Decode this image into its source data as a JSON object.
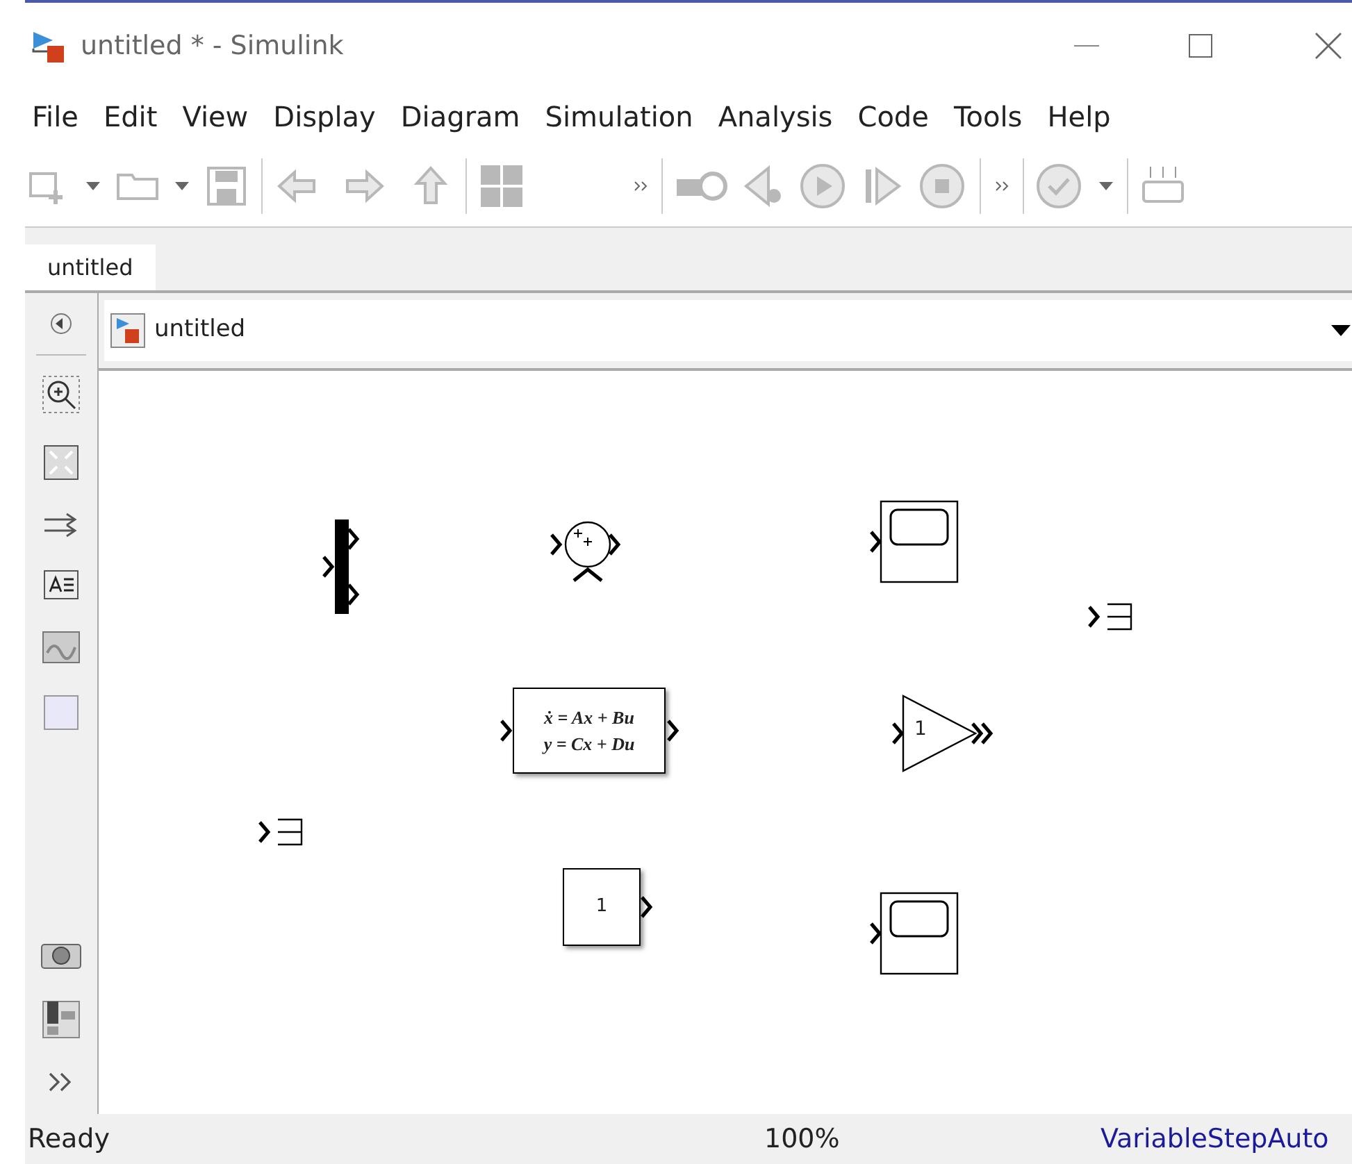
{
  "window": {
    "title": "untitled * - Simulink"
  },
  "menu": [
    "File",
    "Edit",
    "View",
    "Display",
    "Diagram",
    "Simulation",
    "Analysis",
    "Code",
    "Tools",
    "Help"
  ],
  "tabs": [
    {
      "label": "untitled",
      "selected": true
    }
  ],
  "address_bar": {
    "path": "untitled"
  },
  "blocks": [
    {
      "kind": "mux"
    },
    {
      "kind": "sum"
    },
    {
      "kind": "scope"
    },
    {
      "kind": "terminator"
    },
    {
      "kind": "state_space",
      "lines": [
        "ẋ = Ax + Bu",
        "y = Cx + Du"
      ]
    },
    {
      "kind": "gain",
      "label": "1"
    },
    {
      "kind": "terminator"
    },
    {
      "kind": "constant",
      "label": "1"
    },
    {
      "kind": "scope"
    }
  ],
  "status_bar": {
    "state": "Ready",
    "zoom": "100%",
    "solver": "VariableStepAuto"
  }
}
